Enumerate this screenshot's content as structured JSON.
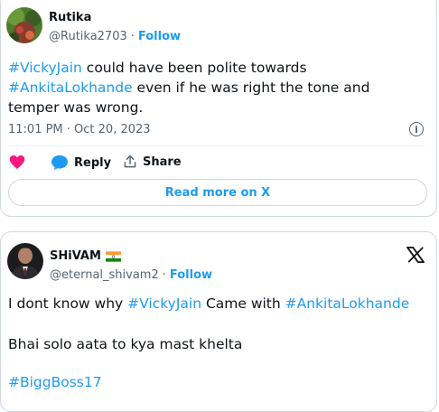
{
  "tweet1": {
    "name": "Rutika",
    "handle": "@Rutika2703",
    "separator": "·",
    "follow": "Follow",
    "body_parts": [
      {
        "text": "#VickyJain",
        "tag": true
      },
      {
        "text": " could have been polite towards ",
        "tag": false
      },
      {
        "text": "#AnkitaLokhande",
        "tag": true
      },
      {
        "text": " even if he was right the tone and temper was wrong.",
        "tag": false
      }
    ],
    "timestamp": "11:01 PM · Oct 20, 2023",
    "actions": {
      "reply": "Reply",
      "share": "Share"
    },
    "read_more": "Read more on X",
    "colors": {
      "like": "#f91880",
      "link": "#1d9bf0"
    }
  },
  "tweet2": {
    "name": "SHiVAM",
    "flag": "india-flag",
    "handle": "@eternal_shivam2",
    "separator": "·",
    "follow": "Follow",
    "line1_parts": [
      {
        "text": "I dont know why ",
        "tag": false
      },
      {
        "text": "#VickyJain",
        "tag": true
      },
      {
        "text": " Came with ",
        "tag": false
      },
      {
        "text": "#AnkitaLokhande",
        "tag": true
      }
    ],
    "line2": "Bhai solo aata to kya mast khelta",
    "line3": "#BiggBoss17",
    "logo": "x-logo"
  }
}
